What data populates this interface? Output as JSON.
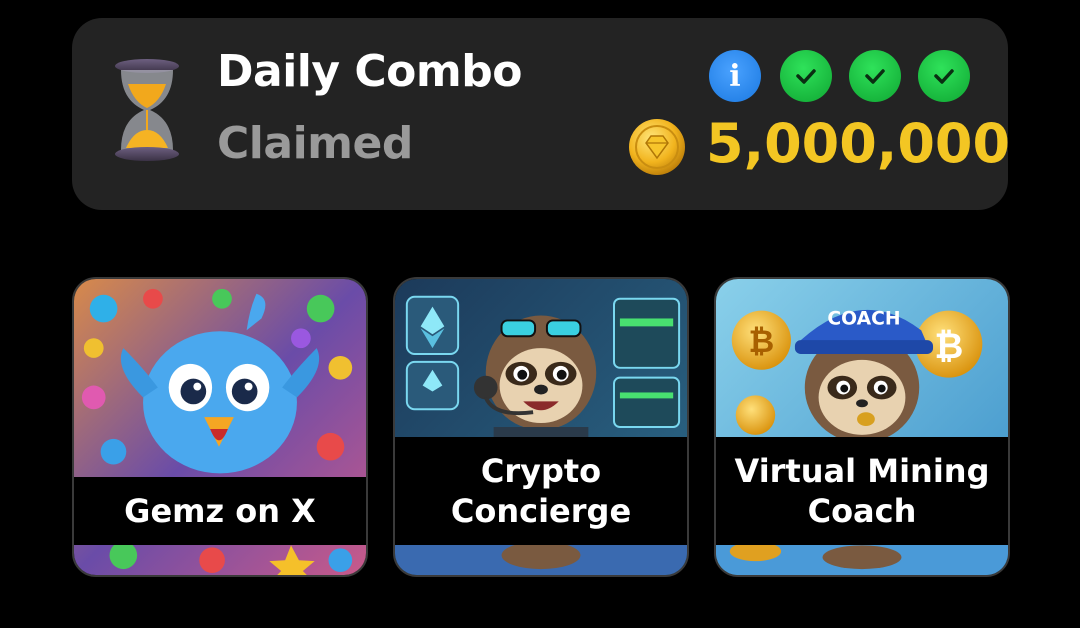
{
  "combo": {
    "title": "Daily Combo",
    "status": "Claimed",
    "reward": "5,000,000",
    "info_icon": "info-icon",
    "checks": [
      "check-icon",
      "check-icon",
      "check-icon"
    ],
    "colors": {
      "panel": "#232323",
      "reward": "#f3c623",
      "check": "#1cc443",
      "info": "#2b8cf0"
    }
  },
  "cards": [
    {
      "title": "Gemz on X",
      "icon": "bird-gems-illustration"
    },
    {
      "title_line1": "Crypto",
      "title_line2": "Concierge",
      "icon": "sloth-headset-illustration"
    },
    {
      "title_line1": "Virtual Mining",
      "title_line2": "Coach",
      "cap_text": "COACH",
      "icon": "sloth-coach-illustration"
    }
  ]
}
